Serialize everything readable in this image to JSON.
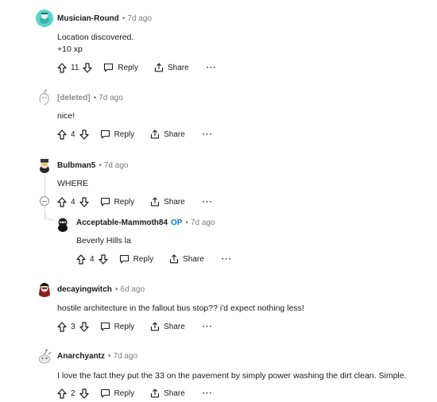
{
  "comments": [
    {
      "author": "Musician-Round",
      "age": "7d ago",
      "lines": [
        "Location discovered.",
        "+10 xp"
      ],
      "score": "11",
      "reply_label": "Reply",
      "share_label": "Share",
      "more_label": "···",
      "avatar_color": "#46d1c3"
    },
    {
      "author": "[deleted]",
      "age": "7d ago",
      "lines": [
        "nice!"
      ],
      "score": "4",
      "reply_label": "Reply",
      "share_label": "Share",
      "more_label": "···"
    },
    {
      "author": "Bulbman5",
      "age": "7d ago",
      "lines": [
        "WHERE"
      ],
      "score": "4",
      "reply_label": "Reply",
      "share_label": "Share",
      "more_label": "···"
    },
    {
      "author": "Acceptable-Mammoth84",
      "op_label": "OP",
      "age": "7d ago",
      "lines": [
        "Beverly Hills la"
      ],
      "score": "4",
      "reply_label": "Reply",
      "share_label": "Share",
      "more_label": "···"
    },
    {
      "author": "decayingwitch",
      "age": "6d ago",
      "lines": [
        "hostile architecture in the fallout bus stop?? i'd expect nothing less!"
      ],
      "score": "3",
      "reply_label": "Reply",
      "share_label": "Share",
      "more_label": "···",
      "avatar_color": "#8b1f1f"
    },
    {
      "author": "Anarchyantz",
      "age": "7d ago",
      "lines": [
        "I love the fact they put the 33 on the pavement by simply power washing the dirt clean. Simple."
      ],
      "score": "2",
      "reply_label": "Reply",
      "share_label": "Share",
      "more_label": "···"
    }
  ],
  "dot": "•",
  "colors": {
    "op": "#0079d3",
    "meta": "#7c7c7c",
    "line": "#d7dadc"
  }
}
